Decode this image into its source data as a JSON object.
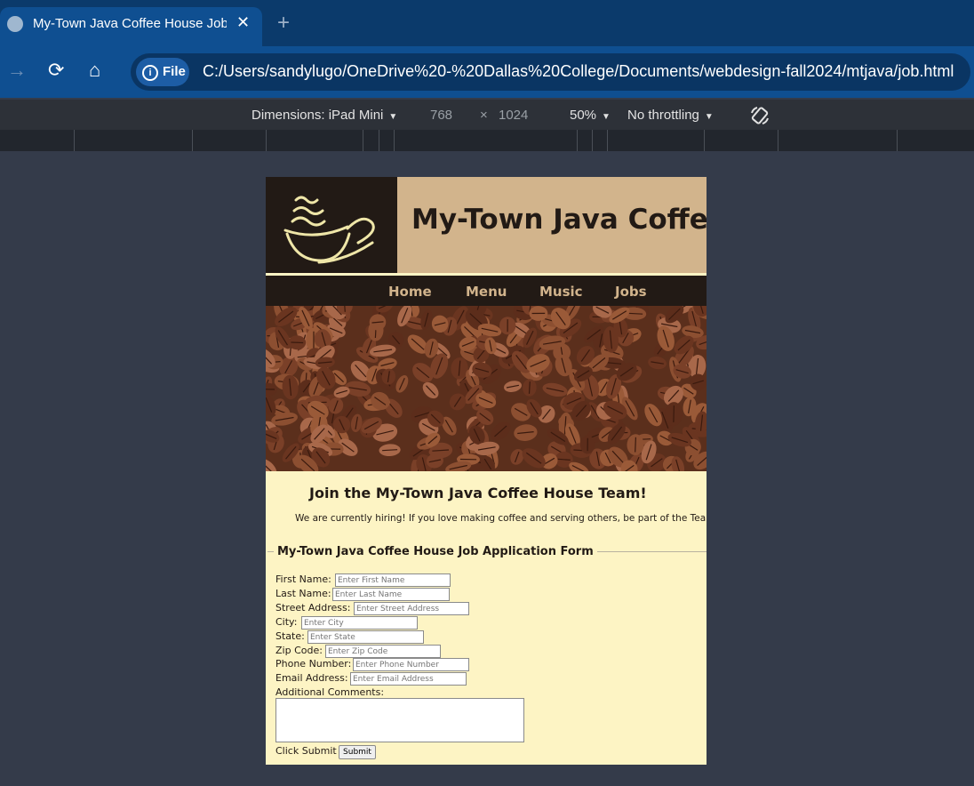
{
  "browser": {
    "tab_title": "My-Town Java Coffee House Jobs",
    "close_glyph": "✕",
    "new_tab_glyph": "+",
    "back_glyph": "→",
    "reload_glyph": "⟳",
    "home_glyph": "⌂",
    "site_chip_label": "File",
    "url": "C:/Users/sandylugo/OneDrive%20-%20Dallas%20College/Documents/webdesign-fall2024/mtjava/job.html"
  },
  "devtools": {
    "dimensions_label": "Dimensions: iPad Mini",
    "width": "768",
    "times": "×",
    "height": "1024",
    "zoom": "50%",
    "throttling": "No throttling",
    "caret": "▼"
  },
  "site": {
    "title": "My-Town Java Coffee House",
    "nav": [
      "Home",
      "Menu",
      "Music",
      "Jobs"
    ],
    "heading": "Join the My-Town Java Coffee House Team!",
    "intro": "We are currently hiring! If you love making coffee and serving others, be part of the Team!",
    "form": {
      "legend": "My-Town Java Coffee House Job Application Form",
      "fields": [
        {
          "label": "First Name:",
          "placeholder": "Enter First Name"
        },
        {
          "label": "Last Name:",
          "placeholder": "Enter Last Name"
        },
        {
          "label": "Street Address:",
          "placeholder": "Enter Street Address"
        },
        {
          "label": "City:",
          "placeholder": "Enter City"
        },
        {
          "label": "State:",
          "placeholder": "Enter State"
        },
        {
          "label": "Zip Code:",
          "placeholder": "Enter Zip Code"
        },
        {
          "label": "Phone Number:",
          "placeholder": "Enter Phone Number"
        },
        {
          "label": "Email Address:",
          "placeholder": "Enter Email Address"
        }
      ],
      "comments_label": "Additional Comments:",
      "submit_prompt": "Click Submit",
      "submit_label": "Submit"
    }
  },
  "colors": {
    "chrome_dark": "#0b3a6b",
    "chrome_tab": "#0f4f91",
    "page_bg": "#fdf4c4",
    "header_tan": "#d2b48c",
    "dark_brown": "#221a15"
  },
  "icons": [
    "globe-icon",
    "close-icon",
    "new-tab-icon",
    "forward-icon",
    "reload-icon",
    "home-icon",
    "info-icon",
    "rotate-icon",
    "coffee-cup-logo"
  ]
}
